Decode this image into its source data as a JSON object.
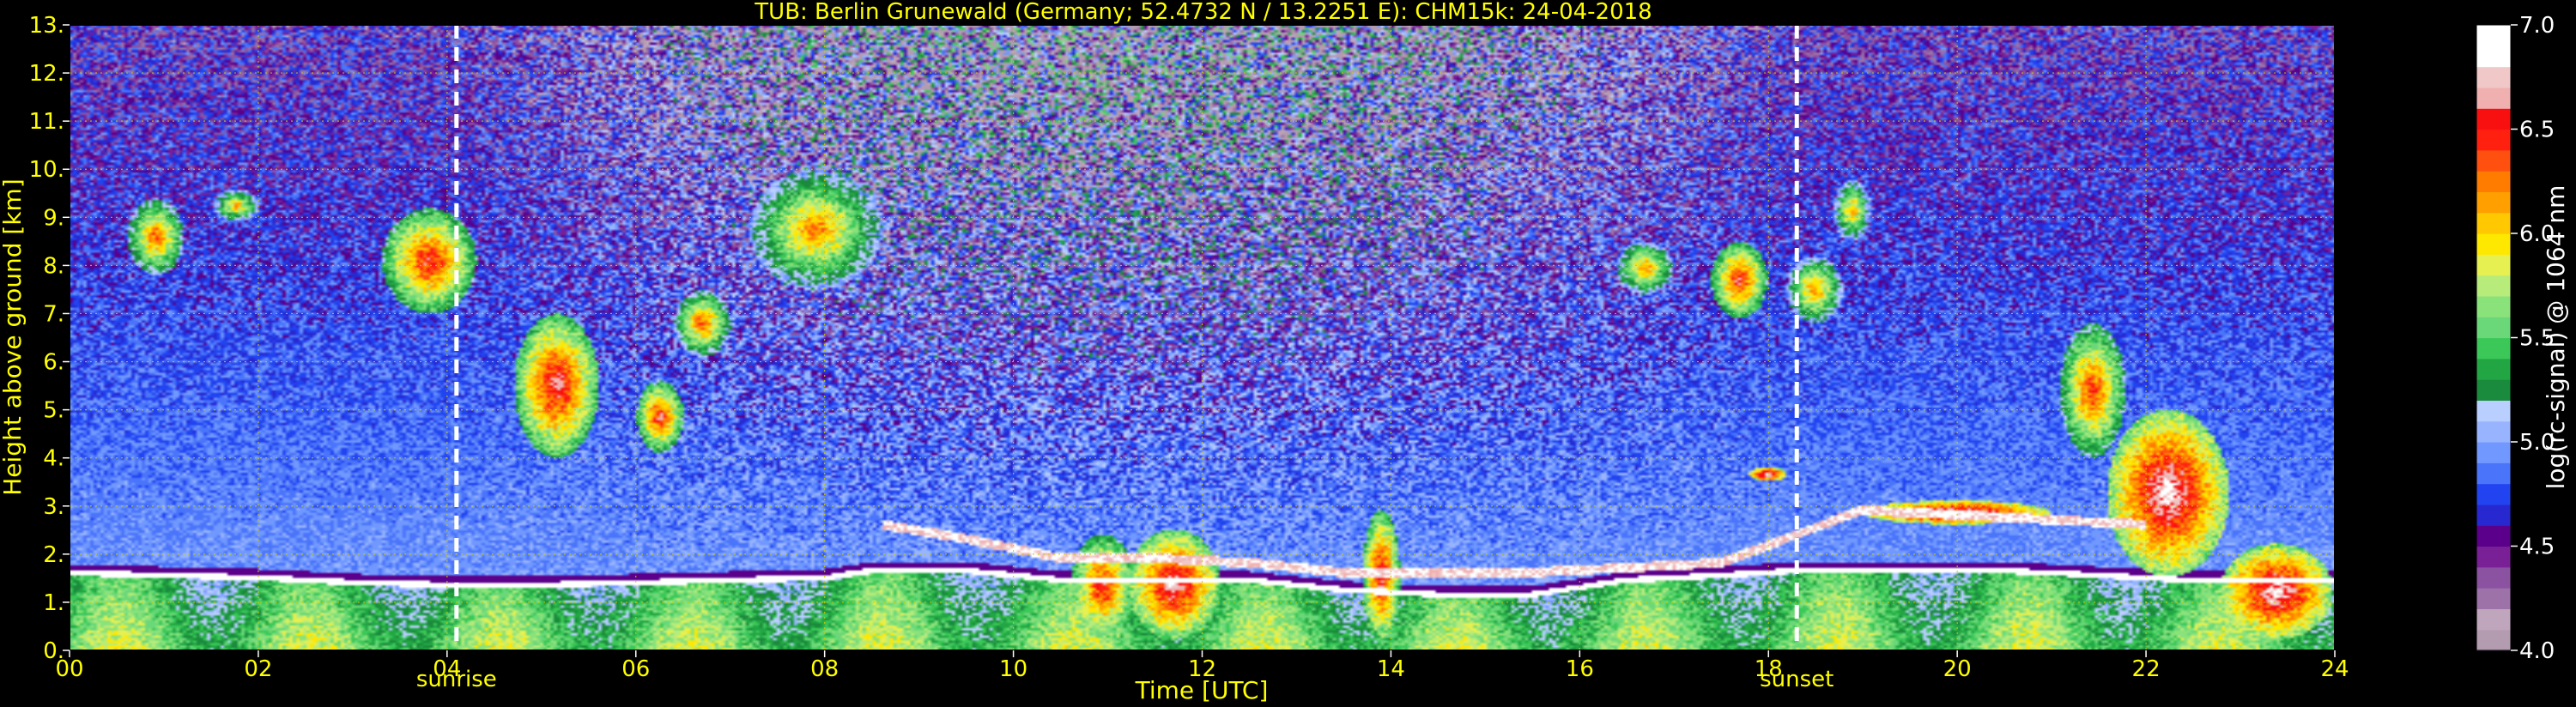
{
  "colors": {
    "background": "#000000",
    "label_text": "#ffff00",
    "grid": "#cccc00",
    "marker_line": "#ffffff",
    "colorbar_text": "#ffffff"
  },
  "chart_data": {
    "type": "heatmap",
    "title": "TUB: Berlin Grunewald (Germany; 52.4732 N / 13.2251 E):    CHM15k: 24-04-2018",
    "xlabel": "Time [UTC]",
    "ylabel": "Height above ground [km]",
    "xlim": [
      0,
      24
    ],
    "ylim": [
      0,
      13
    ],
    "x_ticks": [
      0,
      2,
      4,
      6,
      8,
      10,
      12,
      14,
      16,
      18,
      20,
      22,
      24
    ],
    "x_tick_labels": [
      "00",
      "02",
      "04",
      "06",
      "08",
      "10",
      "12",
      "14",
      "16",
      "18",
      "20",
      "22",
      "24"
    ],
    "y_ticks": [
      0,
      1,
      2,
      3,
      4,
      5,
      6,
      7,
      8,
      9,
      10,
      11,
      12,
      13
    ],
    "y_tick_labels": [
      "0.",
      "1.",
      "2.",
      "3.",
      "4.",
      "5.",
      "6.",
      "7.",
      "8.",
      "9.",
      "10.",
      "11.",
      "12.",
      "13."
    ],
    "grid": true,
    "grid_style": "dotted",
    "markers": [
      {
        "label": "sunrise",
        "time": 4.1
      },
      {
        "label": "sunset",
        "time": 18.3
      }
    ],
    "colorbar": {
      "label": "log(rc-signal) @ 1064 nm",
      "range": [
        4.0,
        7.0
      ],
      "ticks": [
        4.0,
        4.5,
        5.0,
        5.5,
        6.0,
        6.5,
        7.0
      ],
      "tick_labels": [
        "4.0",
        "4.5",
        "5.0",
        "5.5",
        "6.0",
        "6.5",
        "7.0"
      ],
      "steps": [
        "#b49cb0",
        "#c0a6bc",
        "#9c72a8",
        "#8c52a2",
        "#7a2096",
        "#5a008a",
        "#2828d0",
        "#2244f0",
        "#4a74fa",
        "#7098ff",
        "#98b4ff",
        "#b8cfff",
        "#1a8a3c",
        "#22a644",
        "#3cc858",
        "#6ad878",
        "#8ae27a",
        "#b8ec7a",
        "#e6f050",
        "#ffe800",
        "#ffc800",
        "#ffa000",
        "#ff7c00",
        "#ff5010",
        "#ff2010",
        "#f81010",
        "#f0b0b0",
        "#f0c8c8",
        "#ffffff",
        "#ffffff"
      ]
    },
    "features": {
      "boundary_layer_top_km": [
        [
          0.0,
          1.65
        ],
        [
          1.0,
          1.6
        ],
        [
          2.0,
          1.55
        ],
        [
          3.0,
          1.45
        ],
        [
          4.0,
          1.4
        ],
        [
          5.0,
          1.4
        ],
        [
          6.0,
          1.45
        ],
        [
          7.0,
          1.5
        ],
        [
          8.0,
          1.55
        ],
        [
          8.5,
          1.7
        ],
        [
          9.5,
          1.7
        ],
        [
          10.5,
          1.5
        ],
        [
          11.5,
          1.5
        ],
        [
          12.5,
          1.5
        ],
        [
          13.5,
          1.3
        ],
        [
          14.5,
          1.2
        ],
        [
          15.5,
          1.2
        ],
        [
          16.5,
          1.5
        ],
        [
          17.5,
          1.6
        ],
        [
          18.3,
          1.7
        ],
        [
          19.5,
          1.7
        ],
        [
          20.5,
          1.7
        ],
        [
          21.5,
          1.6
        ],
        [
          22.5,
          1.5
        ],
        [
          23.5,
          1.5
        ],
        [
          24.0,
          1.5
        ]
      ],
      "residual_layer_top_km": [
        [
          8.6,
          2.6
        ],
        [
          9.5,
          2.3
        ],
        [
          10.5,
          1.9
        ],
        [
          11.5,
          1.9
        ],
        [
          12.5,
          1.8
        ],
        [
          13.5,
          1.6
        ],
        [
          14.5,
          1.6
        ],
        [
          15.5,
          1.6
        ],
        [
          16.5,
          1.7
        ],
        [
          17.5,
          1.8
        ],
        [
          19.0,
          2.9
        ],
        [
          20.0,
          2.8
        ],
        [
          21.0,
          2.7
        ],
        [
          22.0,
          2.6
        ]
      ],
      "cloud_patches": [
        {
          "t0": 0.6,
          "t1": 1.2,
          "h0": 7.8,
          "h1": 9.4,
          "peak": 6.4
        },
        {
          "t0": 1.5,
          "t1": 2.0,
          "h0": 8.9,
          "h1": 9.6,
          "peak": 6.2
        },
        {
          "t0": 3.3,
          "t1": 4.3,
          "h0": 7.0,
          "h1": 9.2,
          "peak": 6.6
        },
        {
          "t0": 4.7,
          "t1": 5.6,
          "h0": 4.0,
          "h1": 7.0,
          "peak": 6.7
        },
        {
          "t0": 6.0,
          "t1": 6.5,
          "h0": 4.1,
          "h1": 5.6,
          "peak": 6.6
        },
        {
          "t0": 6.4,
          "t1": 7.0,
          "h0": 6.1,
          "h1": 7.5,
          "peak": 6.4
        },
        {
          "t0": 7.2,
          "t1": 8.6,
          "h0": 7.5,
          "h1": 10.0,
          "peak": 6.3
        },
        {
          "t0": 16.4,
          "t1": 17.0,
          "h0": 7.4,
          "h1": 8.5,
          "peak": 6.3
        },
        {
          "t0": 17.4,
          "t1": 18.0,
          "h0": 6.9,
          "h1": 8.5,
          "peak": 6.6
        },
        {
          "t0": 18.2,
          "t1": 18.8,
          "h0": 6.8,
          "h1": 8.2,
          "peak": 6.3
        },
        {
          "t0": 18.7,
          "t1": 19.1,
          "h0": 8.5,
          "h1": 9.8,
          "peak": 6.2
        },
        {
          "t0": 21.1,
          "t1": 21.8,
          "h0": 4.0,
          "h1": 6.8,
          "peak": 6.5
        },
        {
          "t0": 21.6,
          "t1": 22.9,
          "h0": 1.5,
          "h1": 5.0,
          "peak": 6.9
        },
        {
          "t0": 22.8,
          "t1": 24.0,
          "h0": 0.2,
          "h1": 2.2,
          "peak": 6.9
        },
        {
          "t0": 10.6,
          "t1": 11.3,
          "h0": 0.2,
          "h1": 2.4,
          "peak": 6.6
        },
        {
          "t0": 11.2,
          "t1": 12.2,
          "h0": 0.2,
          "h1": 2.5,
          "peak": 6.8
        },
        {
          "t0": 13.7,
          "t1": 14.1,
          "h0": 0.1,
          "h1": 2.9,
          "peak": 6.7
        },
        {
          "t0": 19.0,
          "t1": 21.0,
          "h0": 2.6,
          "h1": 3.1,
          "peak": 7.0
        },
        {
          "t0": 17.8,
          "t1": 18.2,
          "h0": 3.5,
          "h1": 3.8,
          "peak": 7.0
        }
      ]
    }
  }
}
